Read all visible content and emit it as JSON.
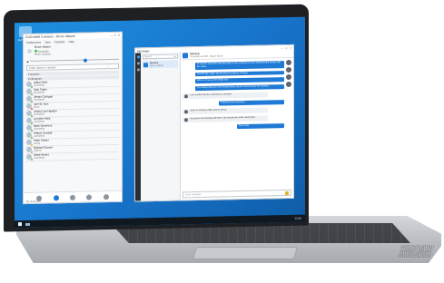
{
  "desktop": {
    "icon_label": "GoSoftphone",
    "taskbar_time": "12:00"
  },
  "contacts_window": {
    "title": "GoGoWell Contacts - Bruce Wayne",
    "menu": [
      "Preferences",
      "View",
      "Contacts",
      "Help"
    ],
    "user_name": "Bruce Wayne",
    "user_status": "Available",
    "user_location": "Work location",
    "search_placeholder": "Enter name or number",
    "groups": [
      "Favorites",
      "Colleagues"
    ],
    "contacts": [
      {
        "name": "Adam Klein",
        "status": "Available"
      },
      {
        "name": "Jack Pyder",
        "status": "Available"
      },
      {
        "name": "James Corrigan",
        "status": "Available"
      },
      {
        "name": "Joel St. Ives",
        "status": "Busy"
      },
      {
        "name": "Jimmy Lee Hayden",
        "status": "Available"
      },
      {
        "name": "Lorraine Kelly",
        "status": "Available"
      },
      {
        "name": "Mark Summers",
        "status": "Available"
      },
      {
        "name": "Patrick Goodall",
        "status": "Available"
      },
      {
        "name": "Peter Parker",
        "status": "Away"
      },
      {
        "name": "Richard Gruson",
        "status": "Offline"
      },
      {
        "name": "Steve Rivers",
        "status": "Available"
      }
    ],
    "footer_label": "My GoGoWell"
  },
  "messages_window": {
    "title": "Messages",
    "search_placeholder": "Search",
    "conversation": {
      "name": "Meeting",
      "sub": "Bruce, Adam"
    },
    "header": {
      "name": "Meeting",
      "sub": "Thursday at 2PM - Board Room"
    },
    "messages": [
      {
        "dir": "out",
        "text": "I'll connect everyone once the call is in the conference room, and share the screen with the slides."
      },
      {
        "dir": "out",
        "text": "Sounds like a plan. Let me know if anything changes."
      },
      {
        "dir": "out",
        "text": "Will do, I'll set up the bridge now."
      },
      {
        "dir": "out",
        "text": "The design files are in the shared folder, please review before the meeting."
      },
      {
        "dir": "in",
        "text": "I can confirm that the conference is booked."
      },
      {
        "dir": "out",
        "text": "Thank you for confirming."
      },
      {
        "dir": "in",
        "text": "I plan on arriving a little early to set up."
      },
      {
        "dir": "in",
        "text": "I'm going to be meeting with them. We should also invite Jack Pyder."
      },
      {
        "dir": "out_short",
        "text": "Sure thing."
      }
    ],
    "composer_placeholder": "Enter message"
  }
}
